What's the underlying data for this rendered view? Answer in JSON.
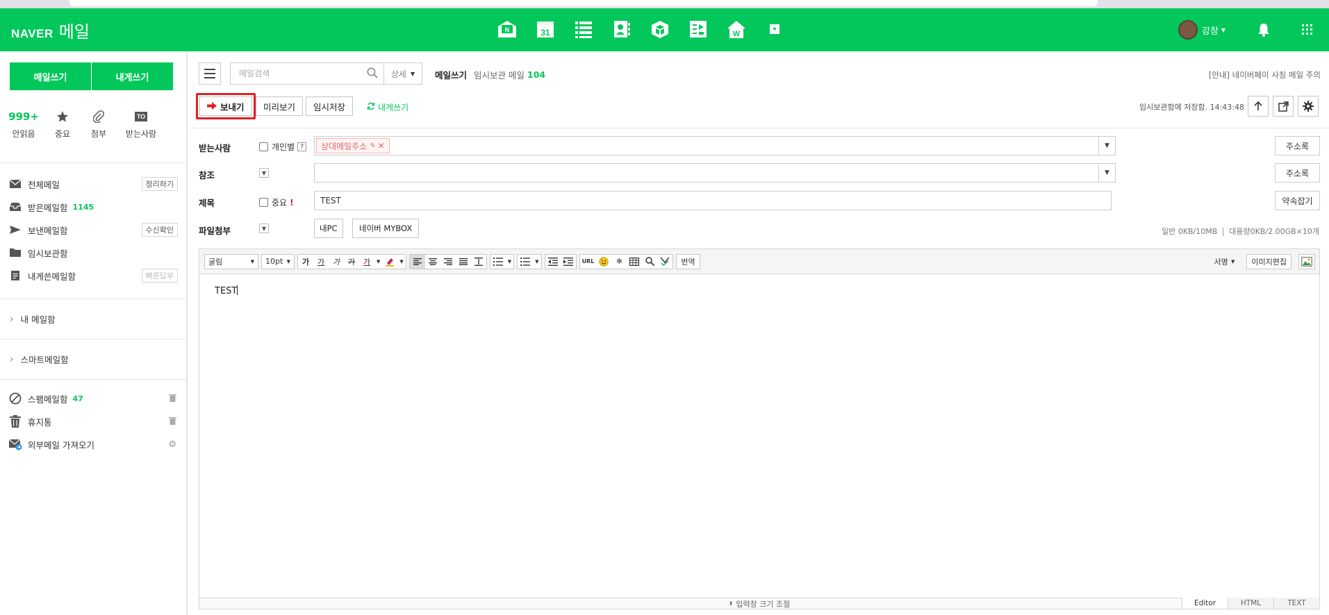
{
  "brand": {
    "naver": "NAVER",
    "mail": "메일"
  },
  "header": {
    "user_name": "강창",
    "apps": [
      "mail",
      "calendar",
      "memo",
      "contacts",
      "mybox",
      "keep",
      "works",
      "more"
    ]
  },
  "sidebar": {
    "compose_label": "메일쓰기",
    "self_compose_label": "내게쓰기",
    "quick": [
      {
        "value": "999+",
        "label": "안읽음"
      },
      {
        "label": "중요",
        "icon": "star-icon"
      },
      {
        "label": "첨부",
        "icon": "paperclip-icon"
      },
      {
        "badge": "TO",
        "label": "받는사람"
      }
    ],
    "mailboxes": [
      {
        "name": "전체메일",
        "action": "정리하기"
      },
      {
        "name": "받은메일함",
        "count": "1145"
      },
      {
        "name": "보낸메일함",
        "action": "수신확인"
      },
      {
        "name": "임시보관함"
      },
      {
        "name": "내게쓴메일함",
        "action": "빠른답부"
      }
    ],
    "groups": [
      "내 메일함",
      "스마트메일함"
    ],
    "bottom": [
      {
        "name": "스팸메일함",
        "count": "47"
      },
      {
        "name": "휴지통"
      },
      {
        "name": "외부메일 가져오기"
      }
    ]
  },
  "main": {
    "search_placeholder": "메일검색",
    "search_detail": "상세",
    "compose_title": "메일쓰기",
    "draft_label": "임시보관 메일",
    "draft_count": "104",
    "notice": "[안내] 네이버페이 사칭 메일 주의",
    "toolbar": {
      "send": "보내기",
      "preview": "미리보기",
      "save": "임시저장",
      "self": "내게쓰기"
    },
    "saved_text": "임시보관함에 저장함. 14:43:48",
    "fields": {
      "to_label": "받는사람",
      "individual_label": "개인별",
      "help": "?",
      "to_chip": "상대메일주소",
      "cc_label": "참조",
      "subject_label": "제목",
      "important_label": "중요",
      "subject_value": "TEST",
      "attach_label": "파일첨부",
      "my_pc": "내PC",
      "naver_mybox": "네이버 MYBOX",
      "addressbook": "주소록",
      "appointment": "약속잡기",
      "quota_general": "일반 0KB/10MB",
      "quota_large": "대용량0KB/2.00GB×10개"
    },
    "editor": {
      "font": "굴림",
      "size": "10pt",
      "style_buttons": [
        "가",
        "가",
        "가",
        "가",
        "가"
      ],
      "url": "URL",
      "translate": "번역",
      "signature": "서명",
      "image_edit": "이미지편집",
      "content": "TEST",
      "resize": "입력창 크기 조절",
      "modes": [
        "Editor",
        "HTML",
        "TEXT"
      ]
    }
  },
  "colors": {
    "brand_green": "#03c75a",
    "highlight_red": "#e31e24"
  }
}
